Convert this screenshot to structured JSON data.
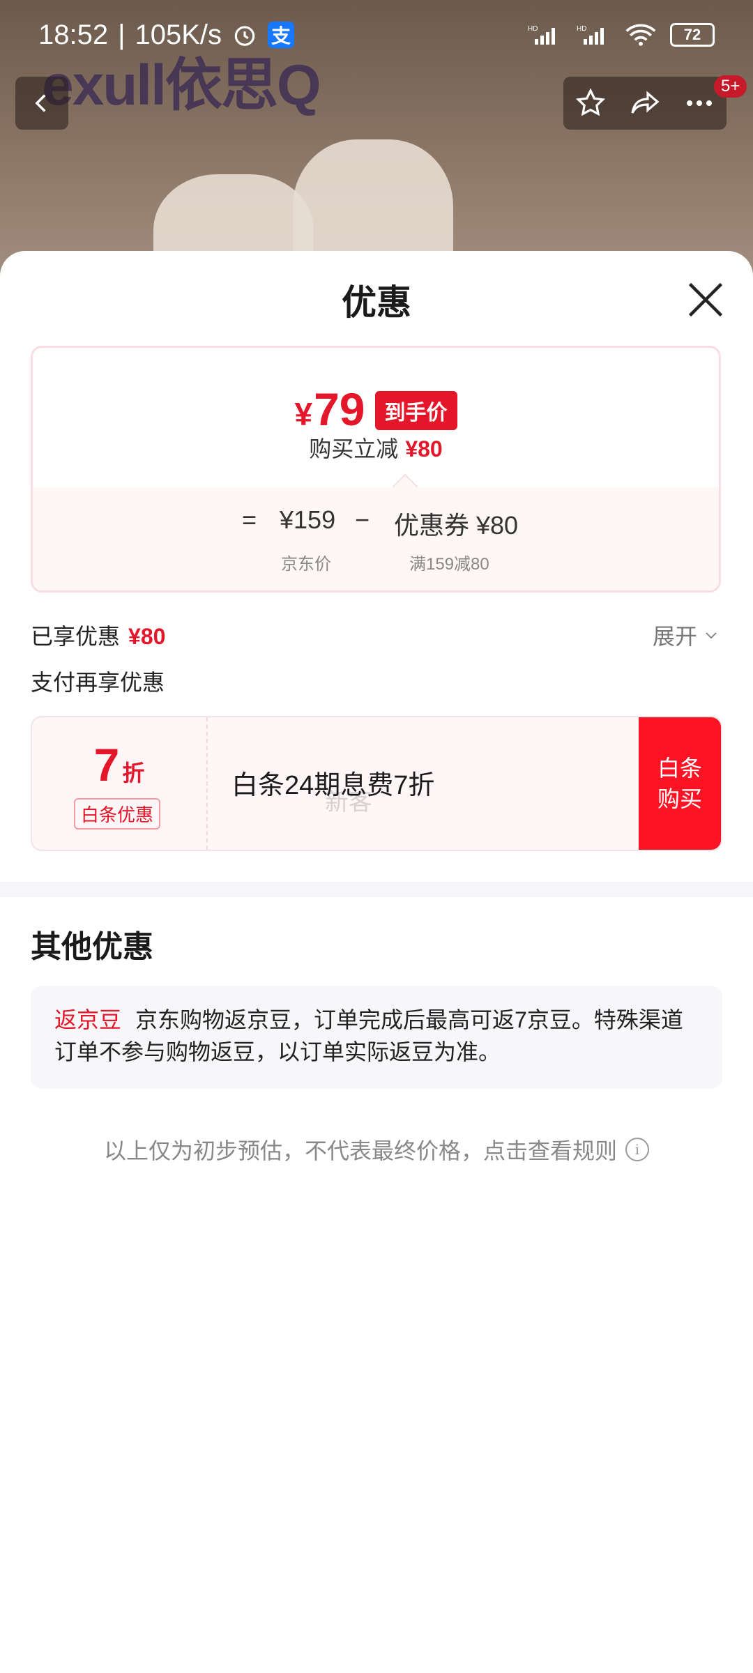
{
  "status_bar": {
    "time": "18:52",
    "speed": "105K/s",
    "battery": "72",
    "signal1": "HD",
    "signal2": "HD"
  },
  "background": {
    "brand": "exull依思Q",
    "more_badge": "5+"
  },
  "sheet": {
    "title": "优惠",
    "price_summary": {
      "final_price": "79",
      "currency": "¥",
      "final_tag": "到手价",
      "save_label": "购买立减",
      "save_amount": "¥80",
      "equals": "=",
      "jd_price": "¥159",
      "minus": "−",
      "coupon_label": "优惠券 ¥80",
      "jd_price_label": "京东价",
      "coupon_rule": "满159减80"
    },
    "enjoyed": {
      "label": "已享优惠",
      "amount": "¥80",
      "expand_label": "展开"
    },
    "pay_more": "支付再享优惠",
    "baitiao": {
      "discount_number": "7",
      "discount_unit": "折",
      "tag": "白条优惠",
      "description": "白条24期息费7折",
      "watermark": "新客",
      "buy_button": "白条购买"
    },
    "other": {
      "title": "其他优惠",
      "bean_tag": "返京豆",
      "bean_text": "京东购物返京豆，订单完成后最高可返7京豆。特殊渠道订单不参与购物返豆，以订单实际返豆为准。"
    },
    "footer_note": "以上仅为初步预估，不代表最终价格，点击查看规则"
  },
  "colors": {
    "accent": "#e4162a",
    "buy_button": "#fc1424"
  }
}
